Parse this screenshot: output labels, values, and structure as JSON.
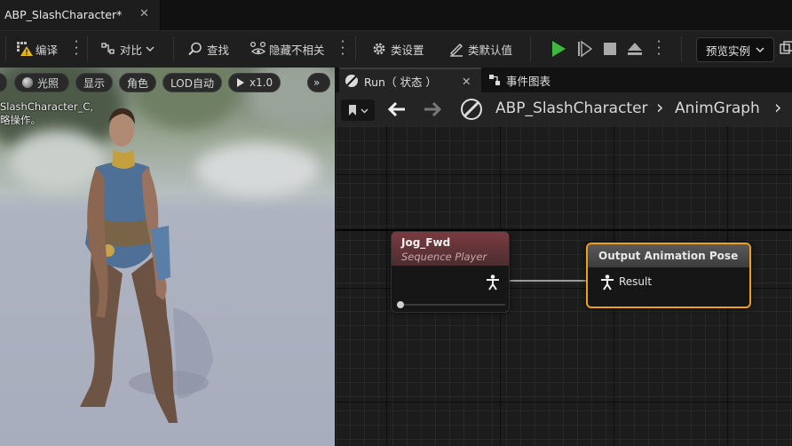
{
  "document_tab": {
    "title": "ABP_SlashCharacter*",
    "close": "✕"
  },
  "toolbar": {
    "compile_label": "编译",
    "diff_label": "对比",
    "find_label": "查找",
    "hide_unrelated_label": "隐藏不相关",
    "class_settings_label": "类设置",
    "class_defaults_label": "类默认值",
    "preview_instance_label": "预览实例"
  },
  "viewport": {
    "pills": {
      "lit": "光照",
      "show": "显示",
      "character": "角色",
      "lod": "LOD自动",
      "speed": "x1.0",
      "more": "»"
    },
    "info_line1": "SlashCharacter_C,",
    "info_line2": "略操作。"
  },
  "graph_tabs": {
    "run_label": "Run（ 状态 ）",
    "run_close": "✕",
    "event_graph_label": "事件图表"
  },
  "breadcrumb": {
    "blueprint": "ABP_SlashCharacter",
    "separator": "›",
    "graph": "AnimGraph",
    "more": "›"
  },
  "nodes": {
    "sequence_player": {
      "title": "Jog_Fwd",
      "subtitle": "Sequence Player"
    },
    "output_pose": {
      "title": "Output Animation Pose",
      "pin_label": "Result",
      "highlight_color": "#f0a11a"
    }
  },
  "colors": {
    "play_button": "#3fb83f",
    "node_header_sequence": "#7a3b40",
    "selection_outline": "#f0a11a"
  }
}
